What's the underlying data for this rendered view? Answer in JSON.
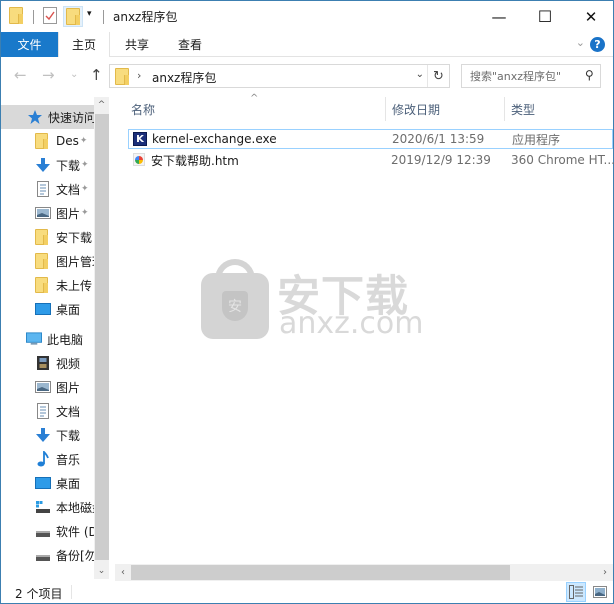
{
  "window": {
    "title": "anxz程序包",
    "controls": {
      "minimize": "—",
      "maximize": "☐",
      "close": "✕"
    }
  },
  "ribbon": {
    "tabs": [
      {
        "label": "文件",
        "type": "file"
      },
      {
        "label": "主页",
        "active": true
      },
      {
        "label": "共享"
      },
      {
        "label": "查看"
      }
    ],
    "help_label": "?",
    "collapse_label": "⌄"
  },
  "addressbar": {
    "path": "anxz程序包",
    "separator": "›",
    "search_placeholder": "搜索\"anxz程序包\"",
    "nav_back": "←",
    "nav_forward": "→",
    "nav_recent": "⌄",
    "nav_up": "↑",
    "dropdown": "⌄",
    "refresh": "↻",
    "search_icon": "⚲"
  },
  "nav_pane": {
    "quick_access": {
      "label": "快速访问",
      "items": [
        {
          "label": "Des",
          "icon": "folder-icon",
          "pinned": true
        },
        {
          "label": "下载",
          "icon": "download-icon",
          "pinned": true
        },
        {
          "label": "文档",
          "icon": "document-icon",
          "pinned": true
        },
        {
          "label": "图片",
          "icon": "picture-icon",
          "pinned": true
        },
        {
          "label": "安下载",
          "icon": "folder-icon"
        },
        {
          "label": "图片管理",
          "icon": "folder-icon"
        },
        {
          "label": "未上传",
          "icon": "folder-icon"
        },
        {
          "label": "桌面",
          "icon": "desktop-icon"
        }
      ]
    },
    "this_pc": {
      "label": "此电脑",
      "items": [
        {
          "label": "视频",
          "icon": "video-icon"
        },
        {
          "label": "图片",
          "icon": "picture-icon"
        },
        {
          "label": "文档",
          "icon": "document-icon"
        },
        {
          "label": "下载",
          "icon": "download-icon"
        },
        {
          "label": "音乐",
          "icon": "music-icon"
        },
        {
          "label": "桌面",
          "icon": "desktop-icon"
        },
        {
          "label": "本地磁盘",
          "icon": "system-drive-icon"
        },
        {
          "label": "软件 (D",
          "icon": "drive-icon"
        },
        {
          "label": "备份[勿",
          "icon": "drive-icon"
        }
      ]
    },
    "pin_glyph": "📌"
  },
  "file_list": {
    "columns": [
      {
        "label": "名称"
      },
      {
        "label": "修改日期"
      },
      {
        "label": "类型"
      }
    ],
    "sort_indicator": "^",
    "files": [
      {
        "name": "kernel-exchange.exe",
        "date": "2020/6/1 13:59",
        "type": "应用程序",
        "icon": "exe-icon",
        "icon_glyph": "K"
      },
      {
        "name": "安下载帮助.htm",
        "date": "2019/12/9 12:39",
        "type": "360 Chrome HT...",
        "icon": "html-file-icon"
      }
    ]
  },
  "watermark": {
    "cn_text": "安下载",
    "en_text": "anxz.com",
    "shield_text": "安"
  },
  "scrollbars": {
    "up": "^",
    "down": "⌄",
    "left": "‹",
    "right": "›"
  },
  "status_bar": {
    "item_count": "2 个项目"
  }
}
